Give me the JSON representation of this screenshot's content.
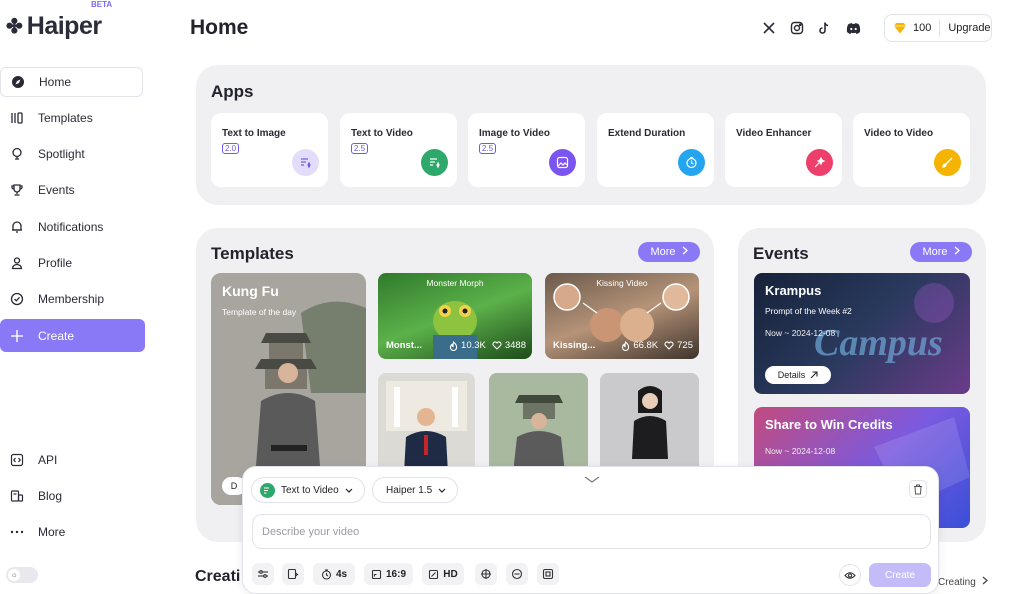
{
  "brand": {
    "name": "Haiper",
    "badge": "BETA"
  },
  "sidebar": {
    "items": [
      {
        "label": "Home",
        "icon": "compass-icon"
      },
      {
        "label": "Templates",
        "icon": "templates-icon"
      },
      {
        "label": "Spotlight",
        "icon": "bulb-icon"
      },
      {
        "label": "Events",
        "icon": "trophy-icon"
      },
      {
        "label": "Notifications",
        "icon": "bell-icon"
      },
      {
        "label": "Profile",
        "icon": "user-icon"
      },
      {
        "label": "Membership",
        "icon": "badge-icon"
      },
      {
        "label": "Create",
        "icon": "plus-icon"
      }
    ],
    "bottom": [
      {
        "label": "API",
        "icon": "code-icon"
      },
      {
        "label": "Blog",
        "icon": "blog-icon"
      },
      {
        "label": "More",
        "icon": "dots-icon"
      }
    ]
  },
  "header": {
    "title": "Home",
    "credits": "100",
    "upgrade": "Upgrade"
  },
  "apps": {
    "title": "Apps",
    "items": [
      {
        "name": "Text to Image",
        "version": "2.0",
        "color": "#e3dcfb"
      },
      {
        "name": "Text to Video",
        "version": "2.5",
        "color": "#2ea86b"
      },
      {
        "name": "Image to Video",
        "version": "2.5",
        "color": "#7a55f0"
      },
      {
        "name": "Extend Duration",
        "version": "",
        "color": "#23a5f0"
      },
      {
        "name": "Video Enhancer",
        "version": "",
        "color": "#ee3f6b"
      },
      {
        "name": "Video to Video",
        "version": "",
        "color": "#f5b400"
      }
    ]
  },
  "templates": {
    "title": "Templates",
    "more": "More",
    "featured": {
      "title": "Kung Fu",
      "subtitle": "Template of the day",
      "button": "D"
    },
    "cards": [
      {
        "name": "Monst...",
        "overlay": "Monster Morph",
        "views": "10.3K",
        "likes": "3488"
      },
      {
        "name": "Kissing...",
        "overlay": "Kissing Video",
        "views": "66.8K",
        "likes": "725"
      }
    ]
  },
  "events": {
    "title": "Events",
    "more": "More",
    "items": [
      {
        "title": "Krampus",
        "subtitle": "Prompt of the Week #2",
        "date": "Now ~ 2024-12-08",
        "button": "Details"
      },
      {
        "title": "Share to Win Credits",
        "date": "Now ~ 2024-12-08"
      }
    ]
  },
  "creations": {
    "title": "Creati",
    "link": "Creating"
  },
  "prompt": {
    "mode": "Text to Video",
    "model": "Haiper 1.5",
    "placeholder": "Describe your video",
    "duration": "4s",
    "ratio": "16:9",
    "quality": "HD",
    "create": "Create"
  }
}
